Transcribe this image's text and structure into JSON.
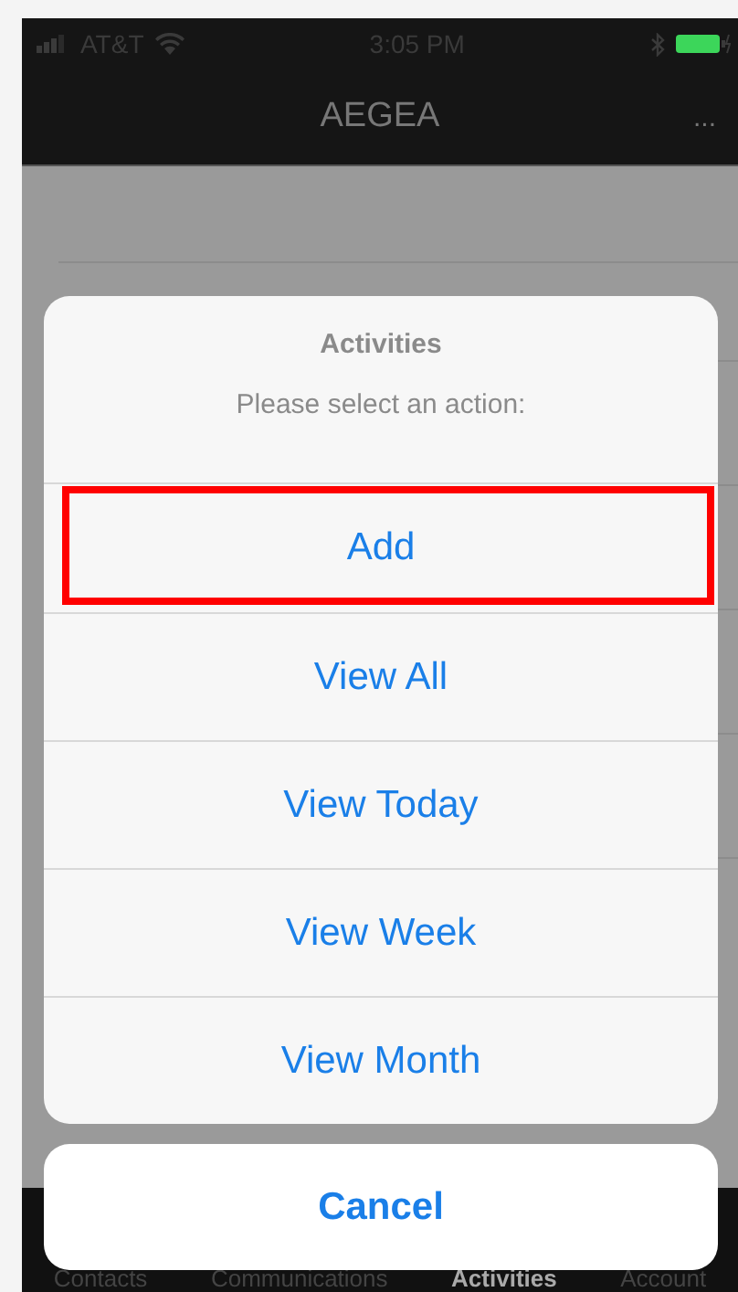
{
  "status_bar": {
    "carrier": "AT&T",
    "time": "3:05 PM"
  },
  "nav_bar": {
    "title": "AEGEA",
    "menu": "..."
  },
  "tab_bar": [
    {
      "label": "Contacts",
      "selected": false
    },
    {
      "label": "Communications",
      "selected": false
    },
    {
      "label": "Activities",
      "selected": true
    },
    {
      "label": "Account",
      "selected": false
    }
  ],
  "action_sheet": {
    "title": "Activities",
    "message": "Please select an action:",
    "actions": [
      {
        "label": "Add",
        "highlighted": true
      },
      {
        "label": "View All",
        "highlighted": false
      },
      {
        "label": "View Today",
        "highlighted": false
      },
      {
        "label": "View Week",
        "highlighted": false
      },
      {
        "label": "View Month",
        "highlighted": false
      }
    ],
    "cancel": "Cancel"
  }
}
